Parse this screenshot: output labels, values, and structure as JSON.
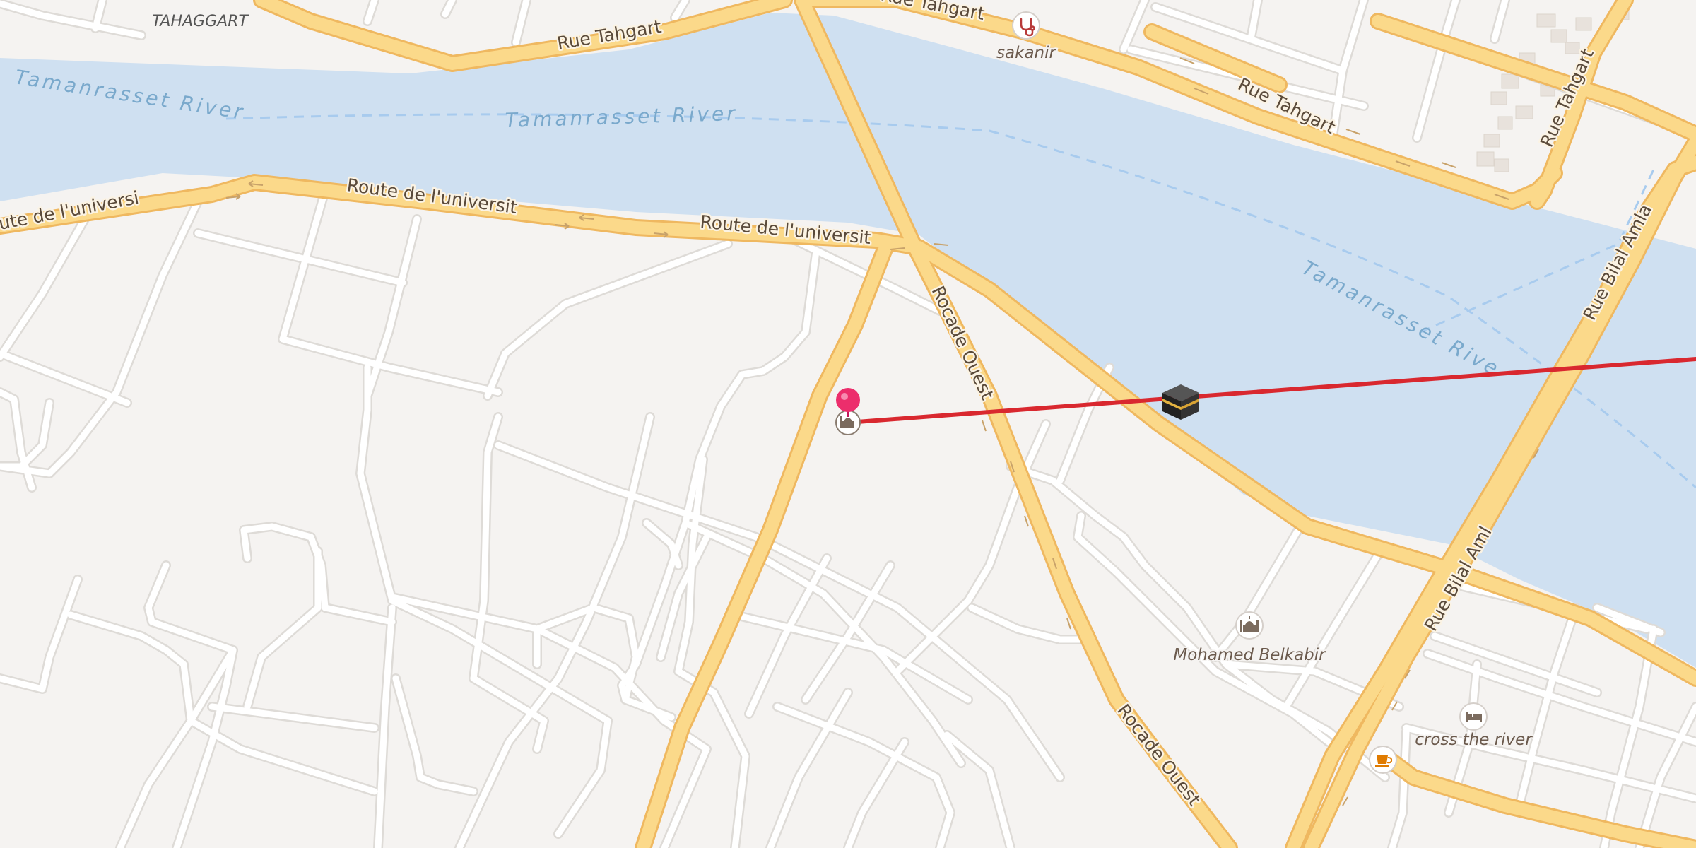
{
  "map": {
    "place": "TAHAGGART",
    "rivers": [
      {
        "id": "r1",
        "name": "Tamanrasset River"
      },
      {
        "id": "r2",
        "name": "Tamanrasset River"
      },
      {
        "id": "r3",
        "name": "Tamanrasset River"
      }
    ],
    "roads": [
      {
        "id": "rd1",
        "name": "Rue Tahgart"
      },
      {
        "id": "rd2",
        "name": "Rue Tahgart"
      },
      {
        "id": "rd3",
        "name": "Rue Tahgart"
      },
      {
        "id": "rd4",
        "name": "Rue Tahgart"
      },
      {
        "id": "rd5",
        "name": "Route de l'université"
      },
      {
        "id": "rd6",
        "name": "Route de l'université"
      },
      {
        "id": "rd7",
        "name": "ute de l'université"
      },
      {
        "id": "rd8",
        "name": "Rocade Ouest"
      },
      {
        "id": "rd9",
        "name": "Rocade Ouest"
      },
      {
        "id": "rd10",
        "name": "Rue Bilal Amlal"
      },
      {
        "id": "rd11",
        "name": "Rue Bilal Amlal"
      }
    ],
    "pois": [
      {
        "id": "p1",
        "name": "sakanir",
        "icon": "stethoscope-icon"
      },
      {
        "id": "p2",
        "name": "Mohamed Belkabir",
        "icon": "mosque-icon"
      },
      {
        "id": "p3",
        "name": "cross the river",
        "icon": "bed-icon"
      },
      {
        "id": "p4",
        "name": "",
        "icon": "cafe-icon"
      }
    ],
    "overlay": {
      "qibla_line_color": "#d9282f",
      "kaaba_icon": "kaaba-icon",
      "pin_icon": "location-pin-icon",
      "origin_icon": "mosque-icon"
    },
    "colors": {
      "land": "#f5f3f1",
      "water": "#cfe0f1",
      "major_road": "#fbd98a",
      "major_road_casing": "#efb860",
      "minor_road": "#ffffff",
      "minor_road_casing": "#dedbd7"
    }
  }
}
